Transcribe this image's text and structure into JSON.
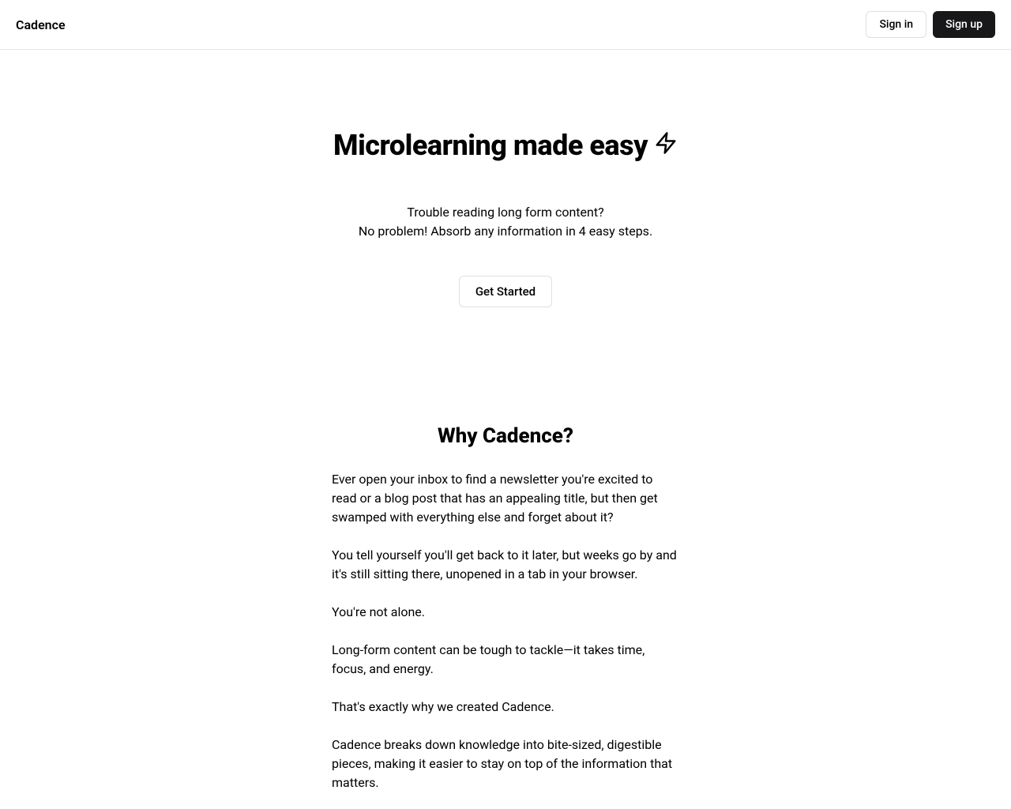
{
  "header": {
    "logo": "Cadence",
    "sign_in": "Sign in",
    "sign_up": "Sign up"
  },
  "hero": {
    "title": "Microlearning made easy",
    "subtitle_line1": "Trouble reading long form content?",
    "subtitle_line2": "No problem! Absorb any information in 4 easy steps.",
    "cta": "Get Started"
  },
  "why": {
    "title": "Why Cadence?",
    "paragraphs": [
      "Ever open your inbox to find a newsletter you're excited to read or a blog post that has an appealing title, but then get swamped with everything else and forget about it?",
      "You tell yourself you'll get back to it later, but weeks go by and it's still sitting there, unopened in a tab in your browser.",
      "You're not alone.",
      "Long-form content can be tough to tackle—it takes time, focus, and energy.",
      "That's exactly why we created Cadence.",
      "Cadence breaks down knowledge into bite-sized, digestible pieces, making it easier to stay on top of the information that matters."
    ]
  }
}
